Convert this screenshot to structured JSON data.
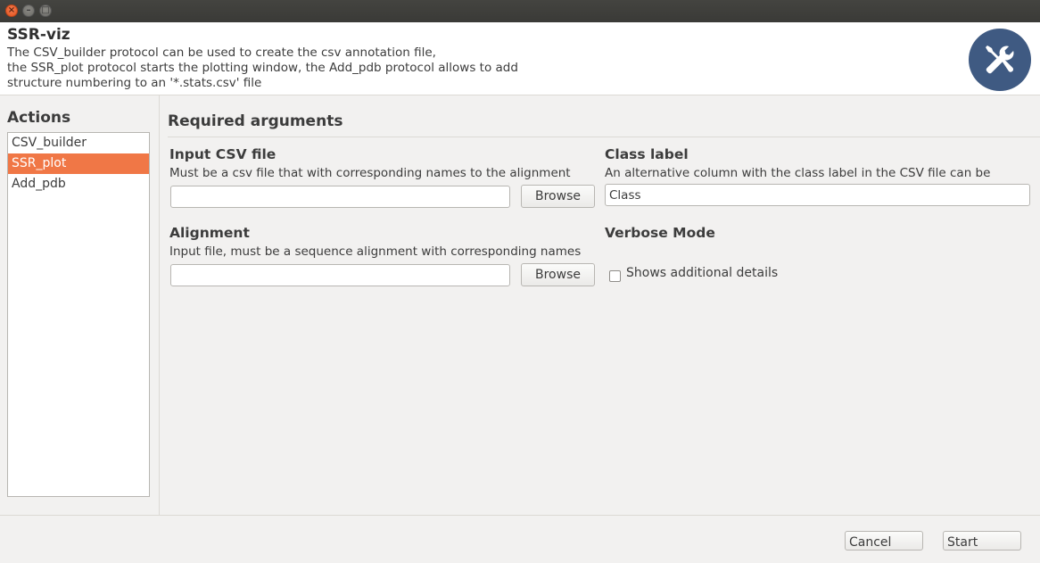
{
  "window": {
    "close_glyph": "×",
    "minimize_glyph": "–",
    "maximize_glyph": "□"
  },
  "header": {
    "title": "SSR-viz",
    "description": "The CSV_builder protocol can be used to create the csv annotation file,\nthe SSR_plot protocol starts the plotting window, the Add_pdb protocol allows to add\nstructure numbering to an '*.stats.csv' file",
    "logo_icon": "tools-icon",
    "logo_color": "#3f5a82"
  },
  "sidebar": {
    "title": "Actions",
    "items": [
      {
        "label": "CSV_builder",
        "selected": false
      },
      {
        "label": "SSR_plot",
        "selected": true
      },
      {
        "label": "Add_pdb",
        "selected": false
      }
    ],
    "selection_color": "#f07746"
  },
  "main": {
    "section_title": "Required arguments",
    "input_csv": {
      "label": "Input CSV file",
      "help": "Must be a csv file that with corresponding names to the alignment",
      "value": "",
      "browse_label": "Browse"
    },
    "class_label": {
      "label": "Class label",
      "help": "An alternative column with the class label in the CSV file can be",
      "value": "Class"
    },
    "alignment": {
      "label": "Alignment",
      "help": "Input file, must be a sequence alignment with corresponding names",
      "value": "",
      "browse_label": "Browse"
    },
    "verbose": {
      "label": "Verbose Mode",
      "checkbox_label": "Shows additional details",
      "checked": false
    }
  },
  "footer": {
    "cancel_label": "Cancel",
    "start_label": "Start"
  }
}
